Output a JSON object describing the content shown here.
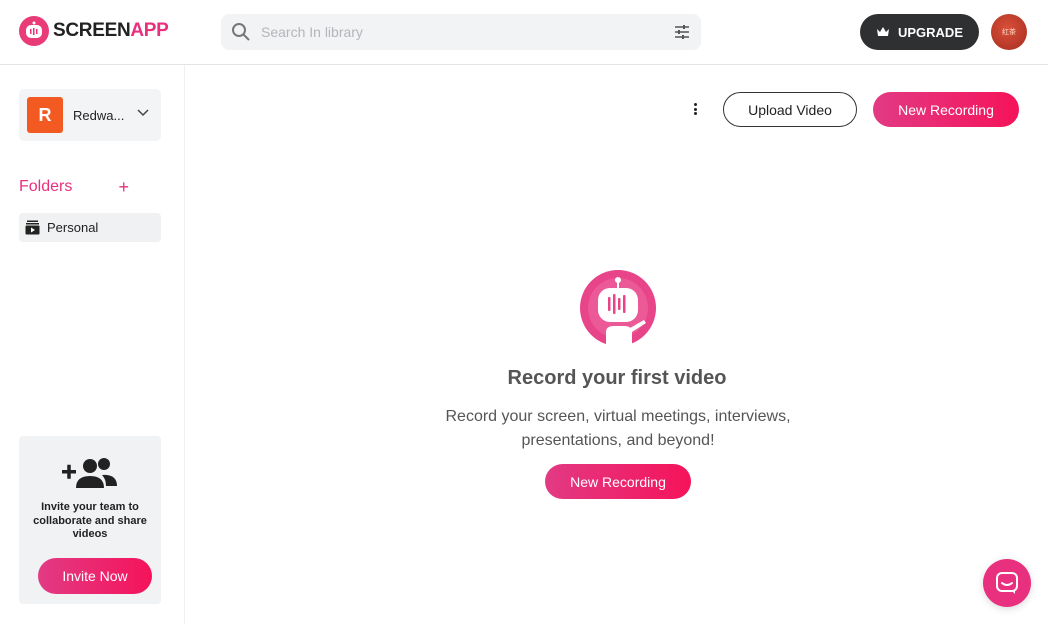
{
  "brand": {
    "name_part1": "SCREEN",
    "name_part2": "APP",
    "accent": "#e8307e"
  },
  "search": {
    "placeholder": "Search In library"
  },
  "header": {
    "upgrade_label": "UPGRADE",
    "avatar_text": "红茶"
  },
  "sidebar": {
    "workspace": {
      "initial": "R",
      "name": "Redwa..."
    },
    "folders_title": "Folders",
    "folders_add": "+",
    "folders": [
      {
        "label": "Personal",
        "icon": "video-folder-icon"
      }
    ],
    "invite": {
      "text": "Invite your team to collaborate and share videos",
      "button_label": "Invite Now"
    }
  },
  "main": {
    "upload_label": "Upload Video",
    "new_recording_label": "New Recording",
    "empty": {
      "title": "Record your first video",
      "description": "Record your screen, virtual meetings, interviews, presentations, and beyond!",
      "button_label": "New Recording"
    }
  },
  "icons": {
    "search": "search-icon",
    "filter": "filter-sliders-icon",
    "crown": "crown-icon",
    "chevron": "chevron-down-icon",
    "invite": "add-team-icon",
    "chat": "chat-icon"
  }
}
